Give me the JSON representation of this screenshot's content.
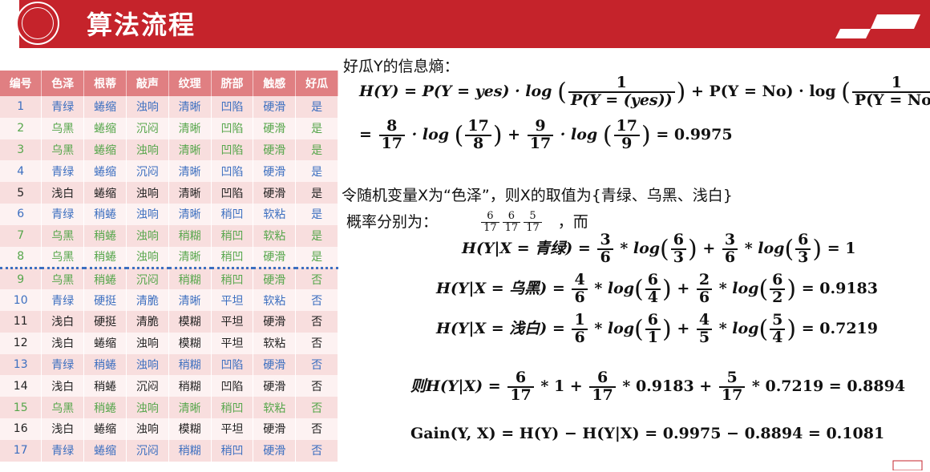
{
  "header": {
    "title": "算法流程"
  },
  "table": {
    "headers": [
      "编号",
      "色泽",
      "根蒂",
      "敲声",
      "纹理",
      "脐部",
      "触感",
      "好瓜"
    ],
    "rows": [
      {
        "c": [
          "1",
          "青绿",
          "蜷缩",
          "浊响",
          "清晰",
          "凹陷",
          "硬滑",
          "是"
        ],
        "color": "blue"
      },
      {
        "c": [
          "2",
          "乌黑",
          "蜷缩",
          "沉闷",
          "清晰",
          "凹陷",
          "硬滑",
          "是"
        ],
        "color": "green"
      },
      {
        "c": [
          "3",
          "乌黑",
          "蜷缩",
          "浊响",
          "清晰",
          "凹陷",
          "硬滑",
          "是"
        ],
        "color": "green"
      },
      {
        "c": [
          "4",
          "青绿",
          "蜷缩",
          "沉闷",
          "清晰",
          "凹陷",
          "硬滑",
          "是"
        ],
        "color": "blue"
      },
      {
        "c": [
          "5",
          "浅白",
          "蜷缩",
          "浊响",
          "清晰",
          "凹陷",
          "硬滑",
          "是"
        ],
        "color": "black"
      },
      {
        "c": [
          "6",
          "青绿",
          "稍蜷",
          "浊响",
          "清晰",
          "稍凹",
          "软粘",
          "是"
        ],
        "color": "blue"
      },
      {
        "c": [
          "7",
          "乌黑",
          "稍蜷",
          "浊响",
          "稍糊",
          "稍凹",
          "软粘",
          "是"
        ],
        "color": "green"
      },
      {
        "c": [
          "8",
          "乌黑",
          "稍蜷",
          "浊响",
          "清晰",
          "稍凹",
          "硬滑",
          "是"
        ],
        "color": "green"
      },
      {
        "c": [
          "9",
          "乌黑",
          "稍蜷",
          "沉闷",
          "稍糊",
          "稍凹",
          "硬滑",
          "否"
        ],
        "color": "green"
      },
      {
        "c": [
          "10",
          "青绿",
          "硬挺",
          "清脆",
          "清晰",
          "平坦",
          "软粘",
          "否"
        ],
        "color": "blue"
      },
      {
        "c": [
          "11",
          "浅白",
          "硬挺",
          "清脆",
          "模糊",
          "平坦",
          "硬滑",
          "否"
        ],
        "color": "black"
      },
      {
        "c": [
          "12",
          "浅白",
          "蜷缩",
          "浊响",
          "模糊",
          "平坦",
          "软粘",
          "否"
        ],
        "color": "black"
      },
      {
        "c": [
          "13",
          "青绿",
          "稍蜷",
          "浊响",
          "稍糊",
          "凹陷",
          "硬滑",
          "否"
        ],
        "color": "blue"
      },
      {
        "c": [
          "14",
          "浅白",
          "稍蜷",
          "沉闷",
          "稍糊",
          "凹陷",
          "硬滑",
          "否"
        ],
        "color": "black"
      },
      {
        "c": [
          "15",
          "乌黑",
          "稍蜷",
          "浊响",
          "清晰",
          "稍凹",
          "软粘",
          "否"
        ],
        "color": "green"
      },
      {
        "c": [
          "16",
          "浅白",
          "蜷缩",
          "浊响",
          "模糊",
          "平坦",
          "硬滑",
          "否"
        ],
        "color": "black"
      },
      {
        "c": [
          "17",
          "青绿",
          "蜷缩",
          "沉闷",
          "稍糊",
          "稍凹",
          "硬滑",
          "否"
        ],
        "color": "blue"
      }
    ]
  },
  "text": {
    "entropy_heading": "好瓜Y的信息熵：",
    "var_line": "令随机变量X为“色泽”，则X的取值为{青绿、乌黑、浅白}",
    "prob_label": "概率分别为：",
    "prob_suffix": "，而",
    "prob_fracs": [
      [
        "6",
        "17"
      ],
      [
        "6",
        "17"
      ],
      [
        "5",
        "17"
      ]
    ]
  },
  "equations": {
    "hy_line1": {
      "lhs": "H(Y) = P(Y = yes) · log",
      "frac1": [
        "1",
        "P(Y = (yes))"
      ],
      "mid": "+ P(Y = No) · log",
      "frac2": [
        "1",
        "P(Y = No)"
      ]
    },
    "hy_line2": {
      "frac_a": [
        "8",
        "17"
      ],
      "log_a": "· log",
      "in_a": [
        "17",
        "8"
      ],
      "plus": "+",
      "frac_b": [
        "9",
        "17"
      ],
      "log_b": "· log",
      "in_b": [
        "17",
        "9"
      ],
      "result": "= 0.9975"
    },
    "cond": [
      {
        "lhs": "H(Y|X = 青绿) =",
        "f1": [
          "3",
          "6"
        ],
        "i1": [
          "6",
          "3"
        ],
        "f2": [
          "3",
          "6"
        ],
        "i2": [
          "6",
          "3"
        ],
        "result": "= 1"
      },
      {
        "lhs": "H(Y|X = 乌黑) =",
        "f1": [
          "4",
          "6"
        ],
        "i1": [
          "6",
          "4"
        ],
        "f2": [
          "2",
          "6"
        ],
        "i2": [
          "6",
          "2"
        ],
        "result": "= 0.9183"
      },
      {
        "lhs": "H(Y|X = 浅白) =",
        "f1": [
          "1",
          "6"
        ],
        "i1": [
          "6",
          "1"
        ],
        "f2": [
          "4",
          "5"
        ],
        "i2": [
          "5",
          "4"
        ],
        "result": "= 0.7219"
      }
    ],
    "total": {
      "lhs": "则H(Y|X) =",
      "f1": [
        "6",
        "17"
      ],
      "t1": "* 1 +",
      "f2": [
        "6",
        "17"
      ],
      "t2": "* 0.9183 +",
      "f3": [
        "5",
        "17"
      ],
      "t3": "* 0.7219 = 0.8894"
    },
    "gain": "Gain(Y, X) = H(Y) − H(Y|X) = 0.9975 − 0.8894 = 0.1081"
  },
  "colors": {
    "header": "#c5232b",
    "table_header": "#e07f82",
    "blue": "#3c6fc0",
    "green": "#56a64b"
  }
}
